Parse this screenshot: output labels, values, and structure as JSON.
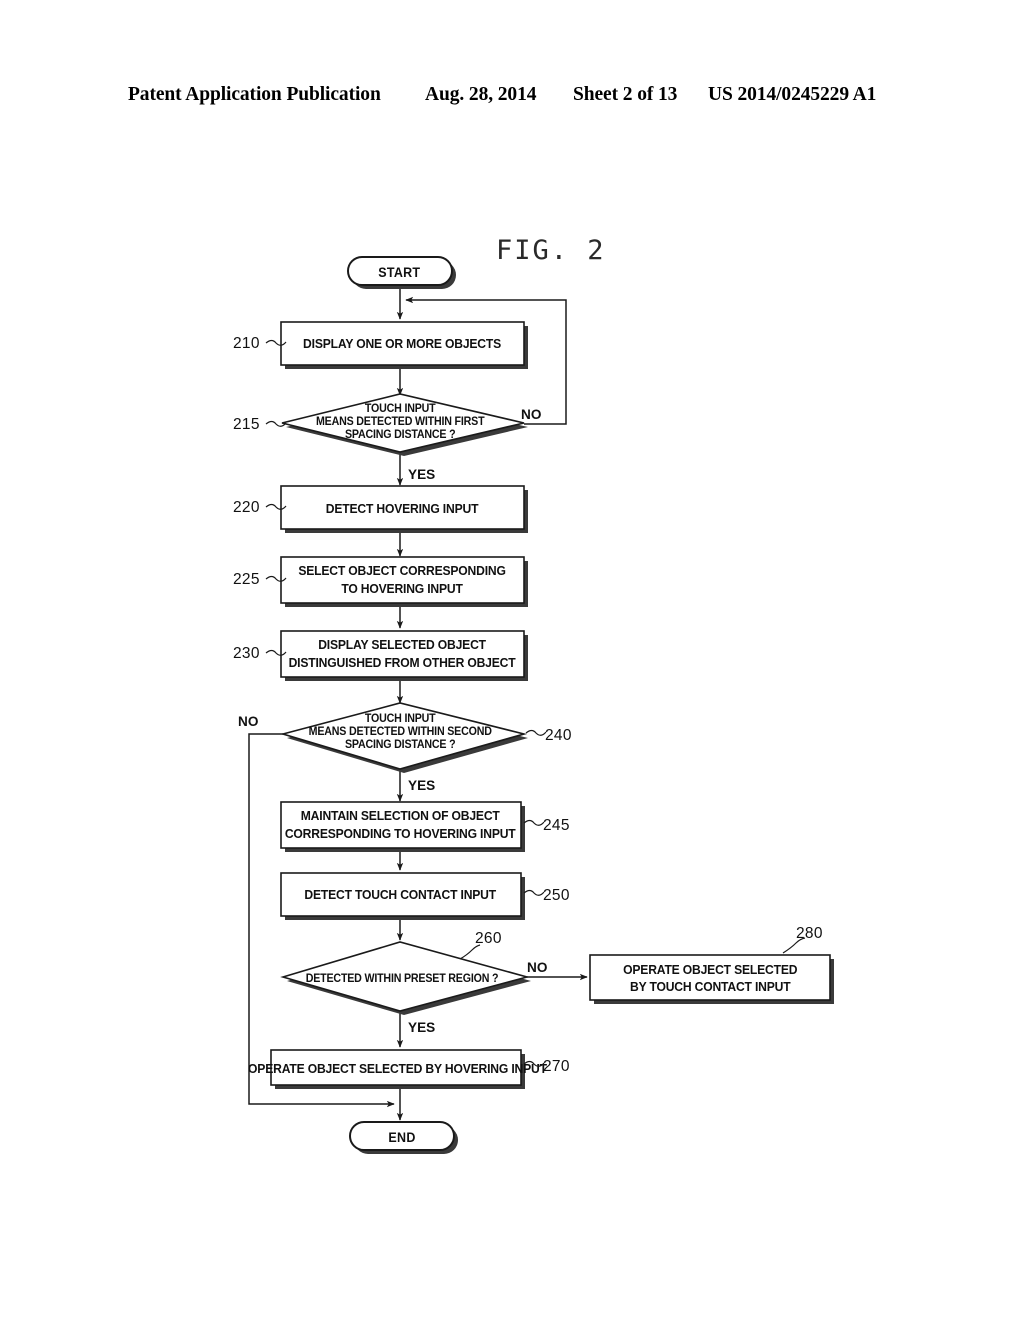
{
  "header": {
    "publication": "Patent Application Publication",
    "date": "Aug. 28, 2014",
    "sheet": "Sheet 2 of 13",
    "patent_number": "US 2014/0245229 A1"
  },
  "figure": {
    "title": "FIG. 2",
    "nodes": {
      "start": {
        "label": "START"
      },
      "end": {
        "label": "END"
      },
      "s210": {
        "ref": "210",
        "line1": "DISPLAY ONE OR MORE OBJECTS"
      },
      "s215": {
        "ref": "215",
        "line1": "TOUCH INPUT",
        "line2": "MEANS DETECTED WITHIN FIRST",
        "line3": "SPACING DISTANCE ?"
      },
      "s220": {
        "ref": "220",
        "line1": "DETECT HOVERING INPUT"
      },
      "s225": {
        "ref": "225",
        "line1": "SELECT OBJECT CORRESPONDING",
        "line2": "TO HOVERING INPUT"
      },
      "s230": {
        "ref": "230",
        "line1": "DISPLAY SELECTED OBJECT",
        "line2": "DISTINGUISHED FROM OTHER OBJECT"
      },
      "s240": {
        "ref": "240",
        "line1": "TOUCH INPUT",
        "line2": "MEANS DETECTED WITHIN SECOND",
        "line3": "SPACING DISTANCE ?"
      },
      "s245": {
        "ref": "245",
        "line1": "MAINTAIN SELECTION OF OBJECT",
        "line2": "CORRESPONDING TO HOVERING INPUT"
      },
      "s250": {
        "ref": "250",
        "line1": "DETECT TOUCH CONTACT INPUT"
      },
      "s260": {
        "ref": "260",
        "line1": "DETECTED WITHIN PRESET REGION ?"
      },
      "s270": {
        "ref": "270",
        "line1": "OPERATE OBJECT SELECTED BY HOVERING INPUT"
      },
      "s280": {
        "ref": "280",
        "line1": "OPERATE OBJECT SELECTED",
        "line2": "BY TOUCH CONTACT INPUT"
      }
    },
    "branches": {
      "no_215": "NO",
      "yes_215": "YES",
      "no_240": "NO",
      "yes_240": "YES",
      "no_260": "NO",
      "yes_260": "YES"
    }
  }
}
